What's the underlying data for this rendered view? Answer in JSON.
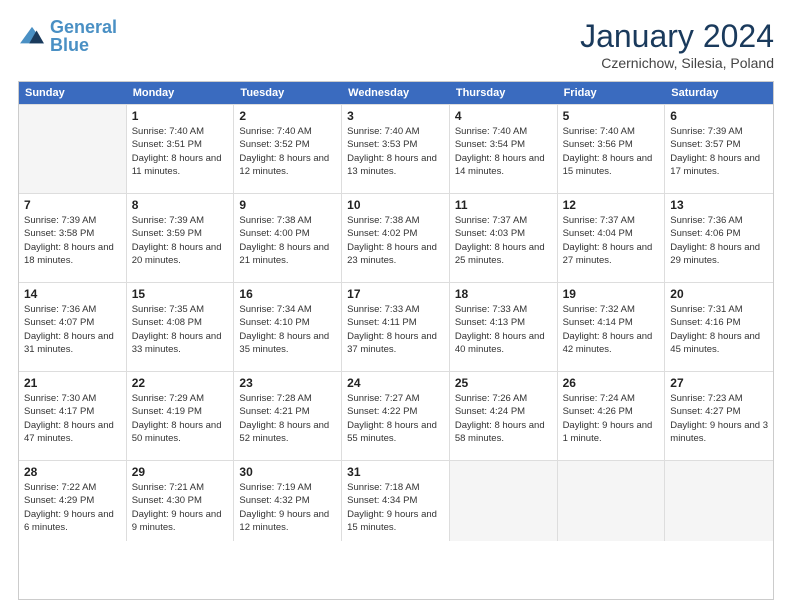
{
  "header": {
    "logo_general": "General",
    "logo_blue": "Blue",
    "month_title": "January 2024",
    "location": "Czernichow, Silesia, Poland"
  },
  "weekdays": [
    "Sunday",
    "Monday",
    "Tuesday",
    "Wednesday",
    "Thursday",
    "Friday",
    "Saturday"
  ],
  "rows": [
    [
      {
        "day": "",
        "empty": true
      },
      {
        "day": "1",
        "sunrise": "Sunrise: 7:40 AM",
        "sunset": "Sunset: 3:51 PM",
        "daylight": "Daylight: 8 hours and 11 minutes."
      },
      {
        "day": "2",
        "sunrise": "Sunrise: 7:40 AM",
        "sunset": "Sunset: 3:52 PM",
        "daylight": "Daylight: 8 hours and 12 minutes."
      },
      {
        "day": "3",
        "sunrise": "Sunrise: 7:40 AM",
        "sunset": "Sunset: 3:53 PM",
        "daylight": "Daylight: 8 hours and 13 minutes."
      },
      {
        "day": "4",
        "sunrise": "Sunrise: 7:40 AM",
        "sunset": "Sunset: 3:54 PM",
        "daylight": "Daylight: 8 hours and 14 minutes."
      },
      {
        "day": "5",
        "sunrise": "Sunrise: 7:40 AM",
        "sunset": "Sunset: 3:56 PM",
        "daylight": "Daylight: 8 hours and 15 minutes."
      },
      {
        "day": "6",
        "sunrise": "Sunrise: 7:39 AM",
        "sunset": "Sunset: 3:57 PM",
        "daylight": "Daylight: 8 hours and 17 minutes."
      }
    ],
    [
      {
        "day": "7",
        "sunrise": "Sunrise: 7:39 AM",
        "sunset": "Sunset: 3:58 PM",
        "daylight": "Daylight: 8 hours and 18 minutes."
      },
      {
        "day": "8",
        "sunrise": "Sunrise: 7:39 AM",
        "sunset": "Sunset: 3:59 PM",
        "daylight": "Daylight: 8 hours and 20 minutes."
      },
      {
        "day": "9",
        "sunrise": "Sunrise: 7:38 AM",
        "sunset": "Sunset: 4:00 PM",
        "daylight": "Daylight: 8 hours and 21 minutes."
      },
      {
        "day": "10",
        "sunrise": "Sunrise: 7:38 AM",
        "sunset": "Sunset: 4:02 PM",
        "daylight": "Daylight: 8 hours and 23 minutes."
      },
      {
        "day": "11",
        "sunrise": "Sunrise: 7:37 AM",
        "sunset": "Sunset: 4:03 PM",
        "daylight": "Daylight: 8 hours and 25 minutes."
      },
      {
        "day": "12",
        "sunrise": "Sunrise: 7:37 AM",
        "sunset": "Sunset: 4:04 PM",
        "daylight": "Daylight: 8 hours and 27 minutes."
      },
      {
        "day": "13",
        "sunrise": "Sunrise: 7:36 AM",
        "sunset": "Sunset: 4:06 PM",
        "daylight": "Daylight: 8 hours and 29 minutes."
      }
    ],
    [
      {
        "day": "14",
        "sunrise": "Sunrise: 7:36 AM",
        "sunset": "Sunset: 4:07 PM",
        "daylight": "Daylight: 8 hours and 31 minutes."
      },
      {
        "day": "15",
        "sunrise": "Sunrise: 7:35 AM",
        "sunset": "Sunset: 4:08 PM",
        "daylight": "Daylight: 8 hours and 33 minutes."
      },
      {
        "day": "16",
        "sunrise": "Sunrise: 7:34 AM",
        "sunset": "Sunset: 4:10 PM",
        "daylight": "Daylight: 8 hours and 35 minutes."
      },
      {
        "day": "17",
        "sunrise": "Sunrise: 7:33 AM",
        "sunset": "Sunset: 4:11 PM",
        "daylight": "Daylight: 8 hours and 37 minutes."
      },
      {
        "day": "18",
        "sunrise": "Sunrise: 7:33 AM",
        "sunset": "Sunset: 4:13 PM",
        "daylight": "Daylight: 8 hours and 40 minutes."
      },
      {
        "day": "19",
        "sunrise": "Sunrise: 7:32 AM",
        "sunset": "Sunset: 4:14 PM",
        "daylight": "Daylight: 8 hours and 42 minutes."
      },
      {
        "day": "20",
        "sunrise": "Sunrise: 7:31 AM",
        "sunset": "Sunset: 4:16 PM",
        "daylight": "Daylight: 8 hours and 45 minutes."
      }
    ],
    [
      {
        "day": "21",
        "sunrise": "Sunrise: 7:30 AM",
        "sunset": "Sunset: 4:17 PM",
        "daylight": "Daylight: 8 hours and 47 minutes."
      },
      {
        "day": "22",
        "sunrise": "Sunrise: 7:29 AM",
        "sunset": "Sunset: 4:19 PM",
        "daylight": "Daylight: 8 hours and 50 minutes."
      },
      {
        "day": "23",
        "sunrise": "Sunrise: 7:28 AM",
        "sunset": "Sunset: 4:21 PM",
        "daylight": "Daylight: 8 hours and 52 minutes."
      },
      {
        "day": "24",
        "sunrise": "Sunrise: 7:27 AM",
        "sunset": "Sunset: 4:22 PM",
        "daylight": "Daylight: 8 hours and 55 minutes."
      },
      {
        "day": "25",
        "sunrise": "Sunrise: 7:26 AM",
        "sunset": "Sunset: 4:24 PM",
        "daylight": "Daylight: 8 hours and 58 minutes."
      },
      {
        "day": "26",
        "sunrise": "Sunrise: 7:24 AM",
        "sunset": "Sunset: 4:26 PM",
        "daylight": "Daylight: 9 hours and 1 minute."
      },
      {
        "day": "27",
        "sunrise": "Sunrise: 7:23 AM",
        "sunset": "Sunset: 4:27 PM",
        "daylight": "Daylight: 9 hours and 3 minutes."
      }
    ],
    [
      {
        "day": "28",
        "sunrise": "Sunrise: 7:22 AM",
        "sunset": "Sunset: 4:29 PM",
        "daylight": "Daylight: 9 hours and 6 minutes."
      },
      {
        "day": "29",
        "sunrise": "Sunrise: 7:21 AM",
        "sunset": "Sunset: 4:30 PM",
        "daylight": "Daylight: 9 hours and 9 minutes."
      },
      {
        "day": "30",
        "sunrise": "Sunrise: 7:19 AM",
        "sunset": "Sunset: 4:32 PM",
        "daylight": "Daylight: 9 hours and 12 minutes."
      },
      {
        "day": "31",
        "sunrise": "Sunrise: 7:18 AM",
        "sunset": "Sunset: 4:34 PM",
        "daylight": "Daylight: 9 hours and 15 minutes."
      },
      {
        "day": "",
        "empty": true
      },
      {
        "day": "",
        "empty": true
      },
      {
        "day": "",
        "empty": true
      }
    ]
  ]
}
